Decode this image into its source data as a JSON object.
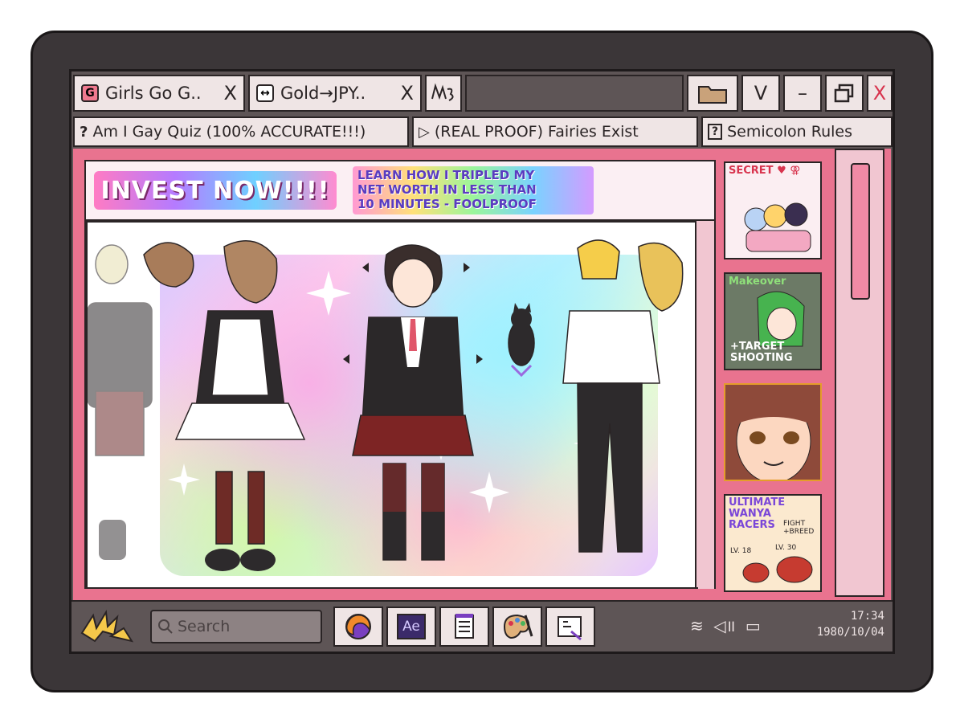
{
  "tabs": [
    {
      "icon": "G",
      "label": "Girls Go G..",
      "close": "X"
    },
    {
      "icon": "↔",
      "label": "Gold→JPY..",
      "close": "X"
    }
  ],
  "window_controls": {
    "folder": "folder-icon",
    "check": "V",
    "minimize": "–",
    "restore": "restore-icon",
    "close": "X"
  },
  "bookmarks": [
    {
      "icon": "?",
      "label": "Am I Gay Quiz (100% ACCURATE!!!)"
    },
    {
      "icon": "▷",
      "label": "(REAL PROOF) Fairies Exist"
    },
    {
      "icon": "?",
      "label": "Semicolon Rules"
    }
  ],
  "ad": {
    "invest": "INVEST NOW!!!!",
    "learn_lines": [
      "LEARN HOW I TRIPLED MY",
      "NET WORTH IN LESS THAN",
      "10 MINUTES - FOOLPROOF"
    ]
  },
  "sidebar_ads": [
    {
      "caption": "SECRET ♥ ⚢"
    },
    {
      "caption": "Makeover",
      "sub": "+TARGET SHOOTING"
    },
    {
      "caption": ""
    },
    {
      "caption": "ULTIMATE WANYA RACERS",
      "sub": "FIGHT +BREED",
      "lv1": "LV. 18",
      "lv2": "LV. 30"
    }
  ],
  "taskbar": {
    "search_placeholder": "Search",
    "apps": [
      "start-icon",
      "browser-icon",
      "Ae",
      "notepad-icon",
      "paint-icon",
      "image-viewer-icon"
    ],
    "time": "17:34",
    "date": "1980/10/04"
  },
  "colors": {
    "accent_pink": "#e9738f",
    "frame_dark": "#3b3638",
    "chrome_gray": "#5e5556",
    "tab_bg": "#efe5e5"
  }
}
